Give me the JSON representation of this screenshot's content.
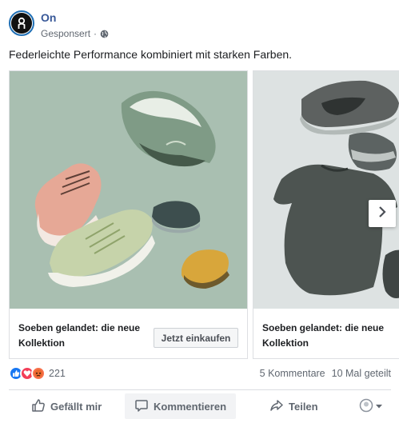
{
  "post": {
    "page_name": "On",
    "sponsored_label": "Gesponsert",
    "separator": "·",
    "caption": "Federleichte Performance kombiniert mit starken Farben."
  },
  "carousel": {
    "cards": [
      {
        "image_alt": "On running shoes in pastel colors floating on sage background",
        "title": "Soeben gelandet: die neue Kollektion",
        "cta_label": "Jetzt einkaufen"
      },
      {
        "image_alt": "Grey On shoes and shirt floating on light grey background",
        "title": "Soeben gelandet: die neue Kollektion"
      }
    ],
    "next_icon": "chevron-right-icon"
  },
  "stats": {
    "reaction_count": "221",
    "comments": "5 Kommentare",
    "shares": "10 Mal geteilt"
  },
  "actions": {
    "like_label": "Gefällt mir",
    "comment_label": "Kommentieren",
    "share_label": "Teilen"
  },
  "colors": {
    "brand_link": "#385898",
    "like_blue": "#1877f2",
    "love_red": "#f33e58",
    "angry_orange": "#f7714c"
  }
}
